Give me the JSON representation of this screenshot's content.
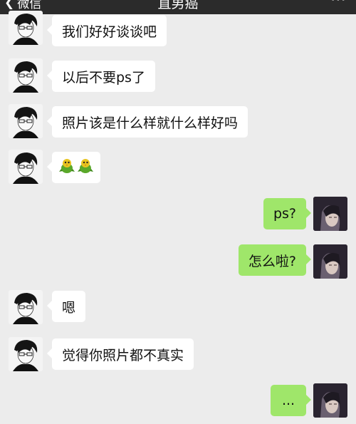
{
  "header": {
    "back_label": "微信",
    "title": "直男癌",
    "more_icon": "more-icon"
  },
  "messages": [
    {
      "side": "left",
      "text": "我们好好谈谈吧"
    },
    {
      "side": "left",
      "text": "以后不要ps了"
    },
    {
      "side": "left",
      "text": "照片该是什么样就什么样好吗"
    },
    {
      "side": "left",
      "text": "",
      "icons": [
        "parrot-emoji-icon",
        "parrot-emoji-icon"
      ]
    },
    {
      "side": "right",
      "text": "ps?"
    },
    {
      "side": "right",
      "text": "怎么啦?"
    },
    {
      "side": "left",
      "text": "嗯"
    },
    {
      "side": "left",
      "text": "觉得你照片都不真实"
    },
    {
      "side": "right",
      "text": "..."
    }
  ],
  "colors": {
    "background": "#ececec",
    "left_bubble": "#ffffff",
    "right_bubble": "#9fe66a",
    "topbar": "#2b2b2b"
  }
}
